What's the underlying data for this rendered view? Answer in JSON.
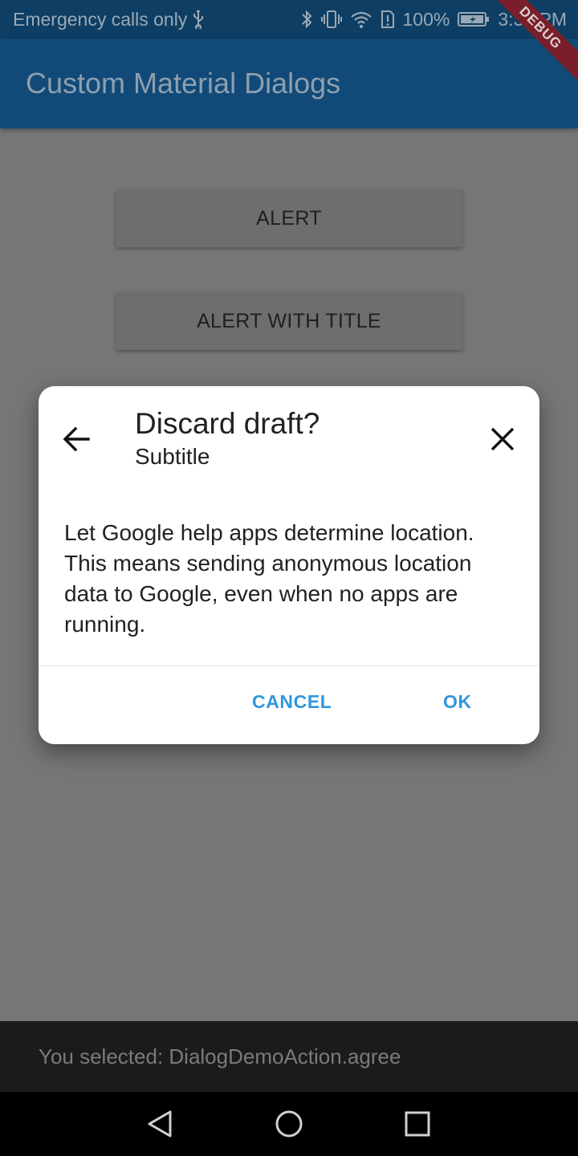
{
  "status_bar": {
    "carrier": "Emergency calls only",
    "battery": "100%",
    "time": "3:37 PM"
  },
  "app_bar": {
    "title": "Custom Material Dialogs",
    "debug_label": "DEBUG"
  },
  "buttons": {
    "alert": "ALERT",
    "alert_with_title": "ALERT WITH TITLE"
  },
  "dialog": {
    "title": "Discard draft?",
    "subtitle": "Subtitle",
    "body": "Let Google help apps determine location. This means sending anonymous location data to Google, even when no apps are running.",
    "cancel": "CANCEL",
    "ok": "OK"
  },
  "snackbar": {
    "text": "You selected: DialogDemoAction.agree"
  },
  "icons": {
    "usb": "usb-icon",
    "bluetooth": "bluetooth-icon",
    "vibrate": "vibrate-icon",
    "wifi": "wifi-icon",
    "sim_alert": "sim-alert-icon",
    "battery": "battery-icon",
    "back": "arrow-back-icon",
    "close": "close-icon",
    "nav_back": "nav-back-icon",
    "nav_home": "nav-home-icon",
    "nav_recents": "nav-recents-icon"
  },
  "colors": {
    "accent": "#2f97dc",
    "app_bar": "#114a78",
    "status_bar": "#0e3e63"
  }
}
